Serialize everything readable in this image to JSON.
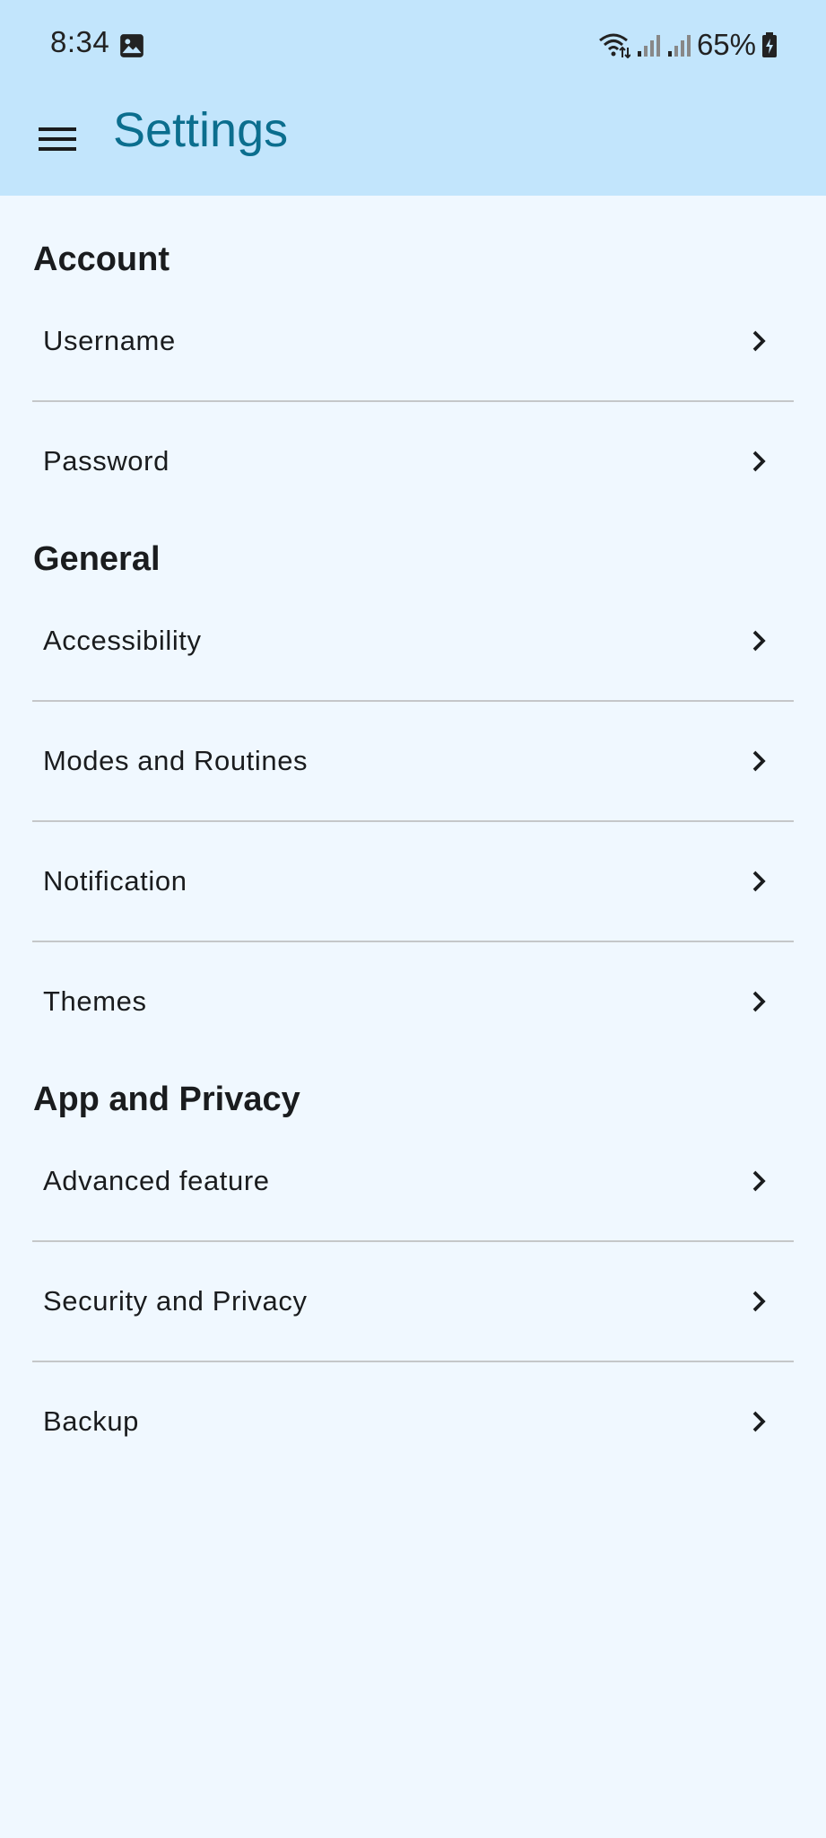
{
  "status_bar": {
    "time": "8:34",
    "battery_percent": "65%",
    "icons": [
      "gallery-icon",
      "wifi-icon",
      "signal-icon-1",
      "signal-icon-2",
      "battery-icon"
    ]
  },
  "app_bar": {
    "title": "Settings",
    "menu_icon": "menu-icon"
  },
  "colors": {
    "app_bar_bg": "#C2E5FC",
    "page_bg": "#F0F8FF",
    "title": "#0B6E8E",
    "text": "#1A1C1E",
    "divider": "#C5C7C9"
  },
  "sections": [
    {
      "header": "Account",
      "items": [
        {
          "label": "Username"
        },
        {
          "label": "Password"
        }
      ]
    },
    {
      "header": "General",
      "items": [
        {
          "label": "Accessibility"
        },
        {
          "label": "Modes and Routines"
        },
        {
          "label": "Notification"
        },
        {
          "label": "Themes"
        }
      ]
    },
    {
      "header": "App and Privacy",
      "items": [
        {
          "label": "Advanced feature"
        },
        {
          "label": "Security and Privacy"
        },
        {
          "label": "Backup"
        }
      ]
    }
  ]
}
